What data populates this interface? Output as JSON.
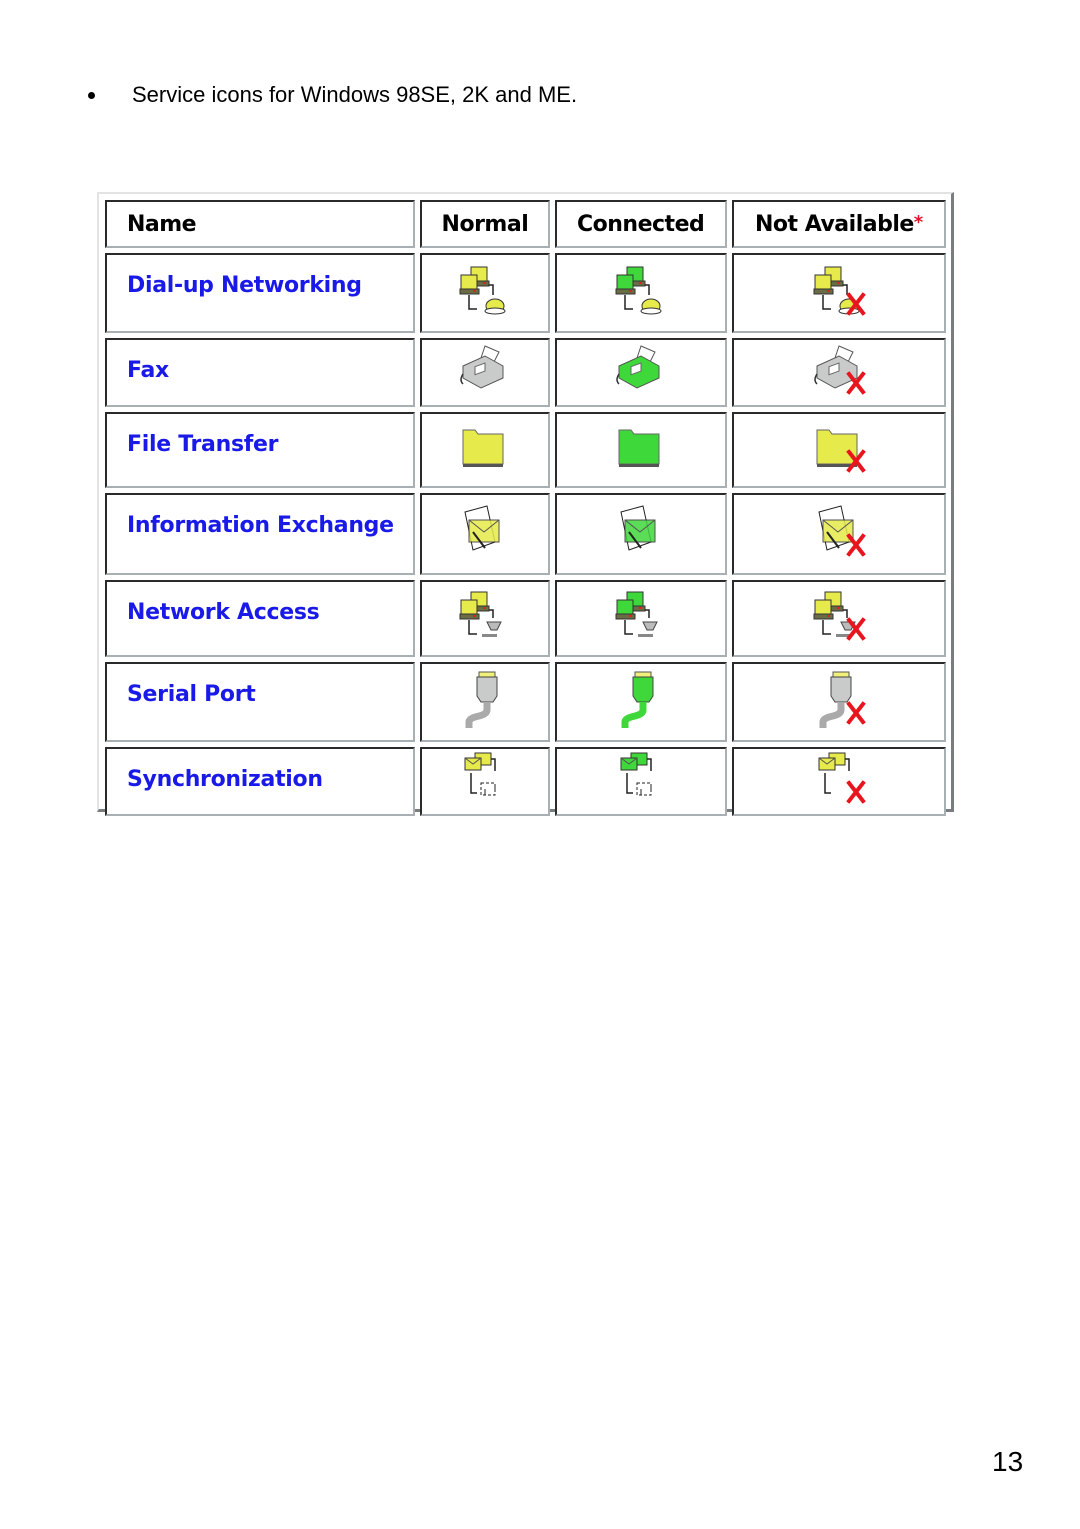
{
  "intro": {
    "bullet_text": "Service icons for Windows 98SE, 2K and ME."
  },
  "table": {
    "headers": {
      "name": "Name",
      "normal": "Normal",
      "connected": "Connected",
      "not_available": "Not Available",
      "not_available_marker": "*"
    },
    "state_colors": {
      "normal": "#e6ea4a",
      "connected": "#3fd83a",
      "not_available_mark": "#e8141e"
    },
    "rows": [
      {
        "name": "Dial-up Networking",
        "icon": "dialup-networking-icon"
      },
      {
        "name": "Fax",
        "icon": "fax-icon"
      },
      {
        "name": "File Transfer",
        "icon": "folder-icon"
      },
      {
        "name": "Information Exchange",
        "icon": "envelope-icon"
      },
      {
        "name": "Network Access",
        "icon": "network-access-icon"
      },
      {
        "name": "Serial Port",
        "icon": "serial-port-icon"
      },
      {
        "name": "Synchronization",
        "icon": "synchronization-icon"
      }
    ]
  },
  "footer": {
    "page_number": "13"
  }
}
